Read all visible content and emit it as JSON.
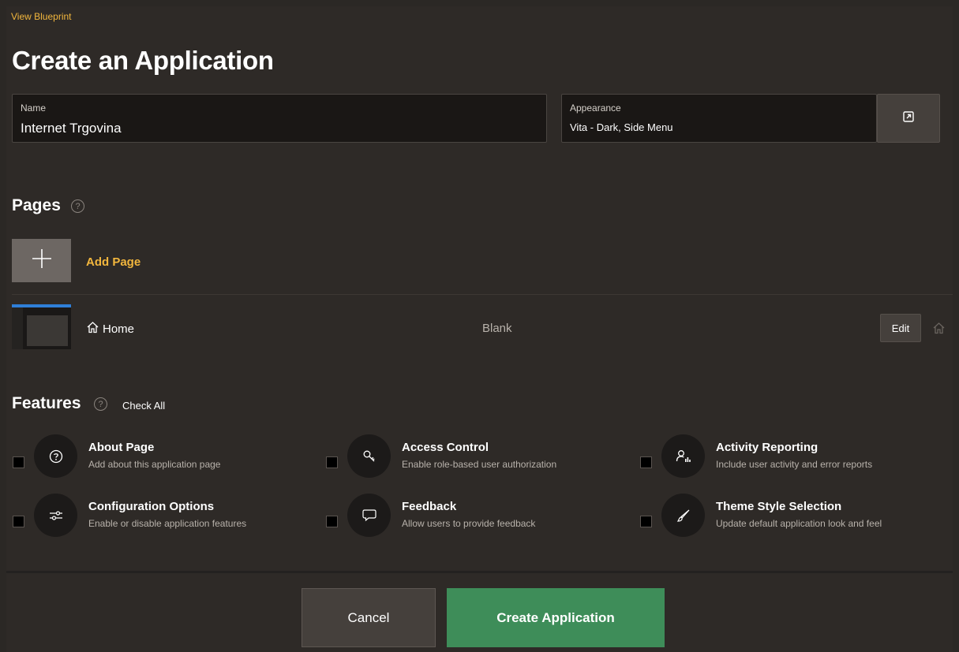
{
  "header": {
    "view_blueprint": "View Blueprint",
    "title": "Create an Application"
  },
  "name_field": {
    "label": "Name",
    "value": "Internet Trgovina"
  },
  "appearance_field": {
    "label": "Appearance",
    "value": "Vita - Dark, Side Menu"
  },
  "pages": {
    "title": "Pages",
    "add_page_label": "Add Page",
    "items": [
      {
        "name": "Home",
        "type": "Blank",
        "edit_label": "Edit"
      }
    ]
  },
  "features": {
    "title": "Features",
    "check_all": "Check All",
    "items": [
      {
        "title": "About Page",
        "desc": "Add about this application page",
        "icon": "question-circle-icon"
      },
      {
        "title": "Access Control",
        "desc": "Enable role-based user authorization",
        "icon": "key-icon"
      },
      {
        "title": "Activity Reporting",
        "desc": "Include user activity and error reports",
        "icon": "user-chart-icon"
      },
      {
        "title": "Configuration Options",
        "desc": "Enable or disable application features",
        "icon": "sliders-icon"
      },
      {
        "title": "Feedback",
        "desc": "Allow users to provide feedback",
        "icon": "comment-icon"
      },
      {
        "title": "Theme Style Selection",
        "desc": "Update default application look and feel",
        "icon": "brush-icon"
      }
    ]
  },
  "footer": {
    "cancel_label": "Cancel",
    "create_label": "Create Application"
  },
  "colors": {
    "accent": "#f2b63d",
    "primary_button": "#3e8d59",
    "background": "#2e2a27"
  }
}
